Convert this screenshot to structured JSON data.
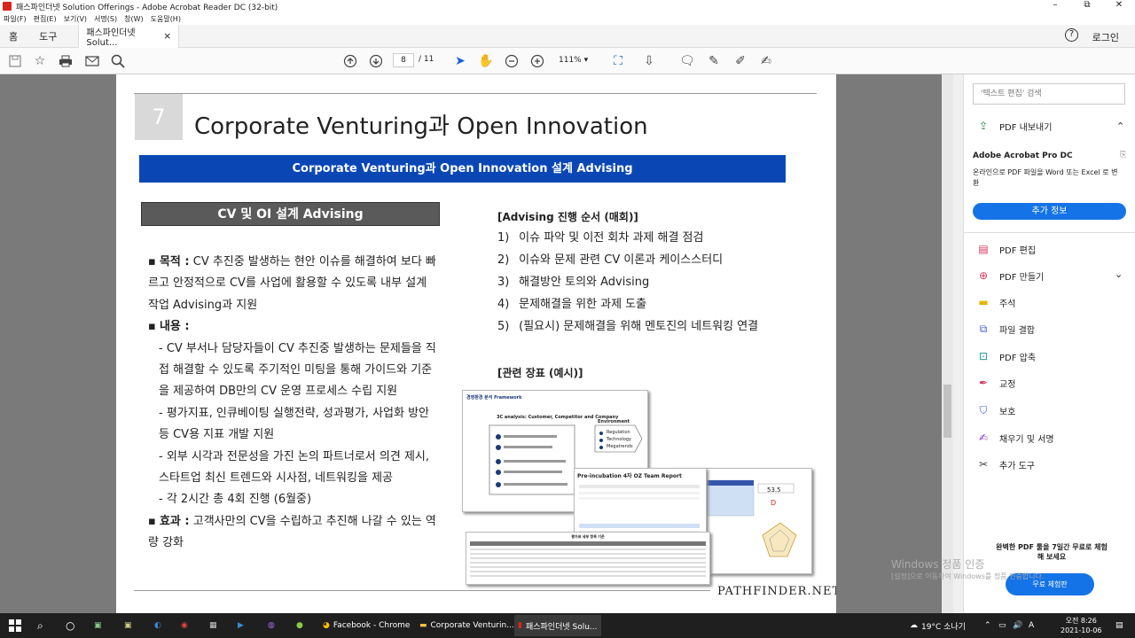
{
  "window": {
    "title": "패스파인더넷 Solution Offerings - Adobe Acrobat Reader DC (32-bit)",
    "controls": [
      "–",
      "⧉",
      "✕"
    ]
  },
  "menu": [
    "파일(F)",
    "편집(E)",
    "보기(V)",
    "서명(S)",
    "창(W)",
    "도움말(H)"
  ],
  "tabs": {
    "home": "홈",
    "tools": "도구",
    "doc_tab": "패스파인더넷 Solut...",
    "close": "×",
    "help": "?",
    "login": "로그인"
  },
  "toolbar": {
    "page_current": "8",
    "page_total": "/ 11",
    "zoom": "111%"
  },
  "page": {
    "number": "7",
    "title": "Corporate Venturing과 Open Innovation",
    "banner": "Corporate Venturing과 Open Innovation 설계 Advising",
    "section": "CV 및 OI 설계 Advising",
    "left": {
      "purpose_label": "목적 :",
      "purpose_text": " CV 추진중 발생하는 현안 이슈를 해결하여 보다 빠르고 안정적으로 CV를 사업에 활용할 수 있도록 내부 설계 작업 Advising과 지원",
      "content_label": "내용 :",
      "c1": "- CV 부서나 담당자들이 CV 추진중 발생하는 문제들을 직접 해결할 수 있도록 주기적인 미팅을 통해 가이드와 기준을 제공하여 DB만의 CV 운영 프로세스 수립 지원",
      "c2": "- 평가지표, 인큐베이팅 실행전략, 성과평가, 사업화 방안 등 CV용 지표 개발 지원",
      "c3": "- 외부 시각과 전문성을 가진 논의 파트너로서 의견 제시, 스타트업 최신 트렌드와 시사점, 네트워킹을 제공",
      "c4": "- 각 2시간 총 4회 진행 (6월중)",
      "effect_label": "효과 :",
      "effect_text": " 고객사만의 CV을 수립하고 추진해 나갈 수 있는 역량 강화"
    },
    "right": {
      "order_title": "[Advising 진행 순서 (매회)]",
      "steps": [
        {
          "n": "1)",
          "t": "이슈 파악 및 이전 회차 과제 해결 점검"
        },
        {
          "n": "2)",
          "t": "이슈와 문제 관련 CV 이론과 케이스스터디"
        },
        {
          "n": "3)",
          "t": "해결방안 토의와 Advising"
        },
        {
          "n": "4)",
          "t": "문제해결을 위한 과제 도출"
        },
        {
          "n": "5)",
          "t": "(필요시) 문제해결을 위해 멘토진의 네트워킹 연결"
        }
      ],
      "docs_title": "[관련 장표 (예시)]",
      "doc1_title": "경영환경 분석 Framework",
      "doc1_sub": "3C analysis: Customer, Competitor and Company",
      "doc1_env": "Environment",
      "doc1_items": [
        "Regulation",
        "Technology",
        "Megatrends"
      ],
      "doc2_title": "Pre-incubation 4차 OZ Team Report",
      "doc3_score": "53.5",
      "doc3_grade": "D",
      "doc4_title": "평가표 세부 항목 기준"
    },
    "logo": "PATHFINDER.NET"
  },
  "right_panel": {
    "search_placeholder": "'텍스트 편집' 검색",
    "export_pdf": "PDF 내보내기",
    "product": "Adobe Acrobat Pro DC",
    "product_desc": "온라인으로 PDF 파일을 Word 또는 Excel 로 변환",
    "more_info": "추가 정보",
    "tools": [
      "PDF 편집",
      "PDF 만들기",
      "주석",
      "파일 결합",
      "PDF 압축",
      "교정",
      "보호",
      "채우기 및 서명",
      "추가 도구"
    ],
    "promo": "완벽한 PDF 툴을 7일간 무료로 체험해 보세요",
    "trial": "무료 체험판"
  },
  "watermark": {
    "line1": "Windows 정품 인증",
    "line2": "[설정]으로 이동하여 Windows를 정품 인증합니다."
  },
  "taskbar": {
    "chrome": "Facebook - Chrome",
    "word": "Corporate Venturin...",
    "acrobat": "패스파인더넷 Solu...",
    "weather": "19°C 소나기",
    "lang": "A",
    "time": "오전 8:26",
    "date": "2021-10-06"
  }
}
